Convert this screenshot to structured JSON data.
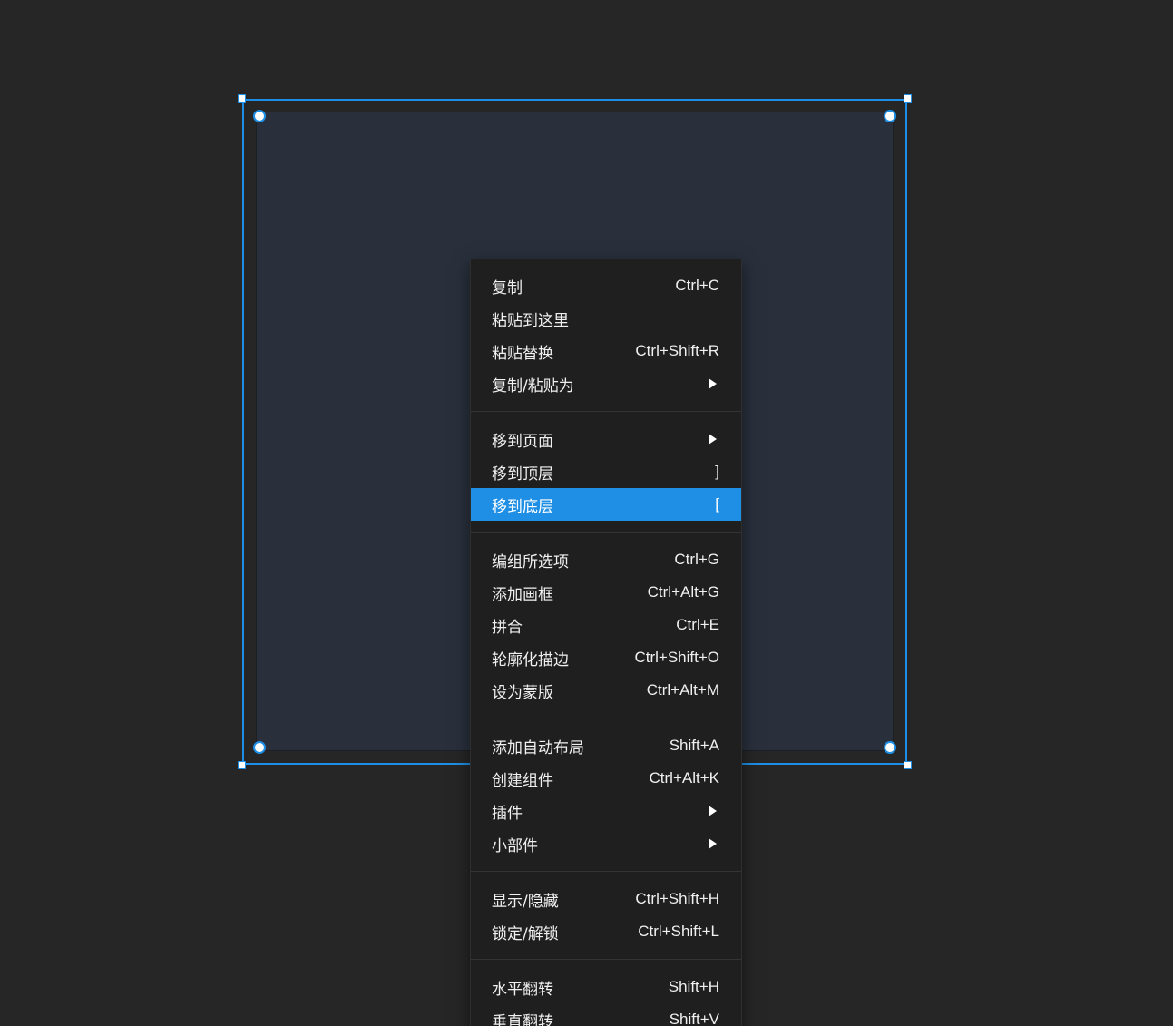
{
  "colors": {
    "canvas_bg": "#262626",
    "frame_fill": "#29303c",
    "selection_accent": "#1e8fe6",
    "menu_bg": "#1f1f1f",
    "menu_text": "#f0f0f0",
    "highlight_bg": "#1f8fe6"
  },
  "context_menu": {
    "groups": [
      {
        "items": [
          {
            "label": "复制",
            "shortcut": "Ctrl+C"
          },
          {
            "label": "粘贴到这里",
            "shortcut": ""
          },
          {
            "label": "粘贴替换",
            "shortcut": "Ctrl+Shift+R"
          },
          {
            "label": "复制/粘贴为",
            "submenu": "chevron-right-icon"
          }
        ]
      },
      {
        "items": [
          {
            "label": "移到页面",
            "submenu": "chevron-right-icon"
          },
          {
            "label": "移到顶层",
            "shortcut": "]"
          },
          {
            "label": "移到底层",
            "shortcut": "[",
            "highlighted": true
          }
        ]
      },
      {
        "items": [
          {
            "label": "编组所选项",
            "shortcut": "Ctrl+G"
          },
          {
            "label": "添加画框",
            "shortcut": "Ctrl+Alt+G"
          },
          {
            "label": "拼合",
            "shortcut": "Ctrl+E"
          },
          {
            "label": "轮廓化描边",
            "shortcut": "Ctrl+Shift+O"
          },
          {
            "label": "设为蒙版",
            "shortcut": "Ctrl+Alt+M"
          }
        ]
      },
      {
        "items": [
          {
            "label": "添加自动布局",
            "shortcut": "Shift+A"
          },
          {
            "label": "创建组件",
            "shortcut": "Ctrl+Alt+K"
          },
          {
            "label": "插件",
            "submenu": "chevron-right-icon"
          },
          {
            "label": "小部件",
            "submenu": "chevron-right-icon"
          }
        ]
      },
      {
        "items": [
          {
            "label": "显示/隐藏",
            "shortcut": "Ctrl+Shift+H"
          },
          {
            "label": "锁定/解锁",
            "shortcut": "Ctrl+Shift+L"
          }
        ]
      },
      {
        "items": [
          {
            "label": "水平翻转",
            "shortcut": "Shift+H"
          },
          {
            "label": "垂直翻转",
            "shortcut": "Shift+V"
          }
        ]
      }
    ]
  }
}
